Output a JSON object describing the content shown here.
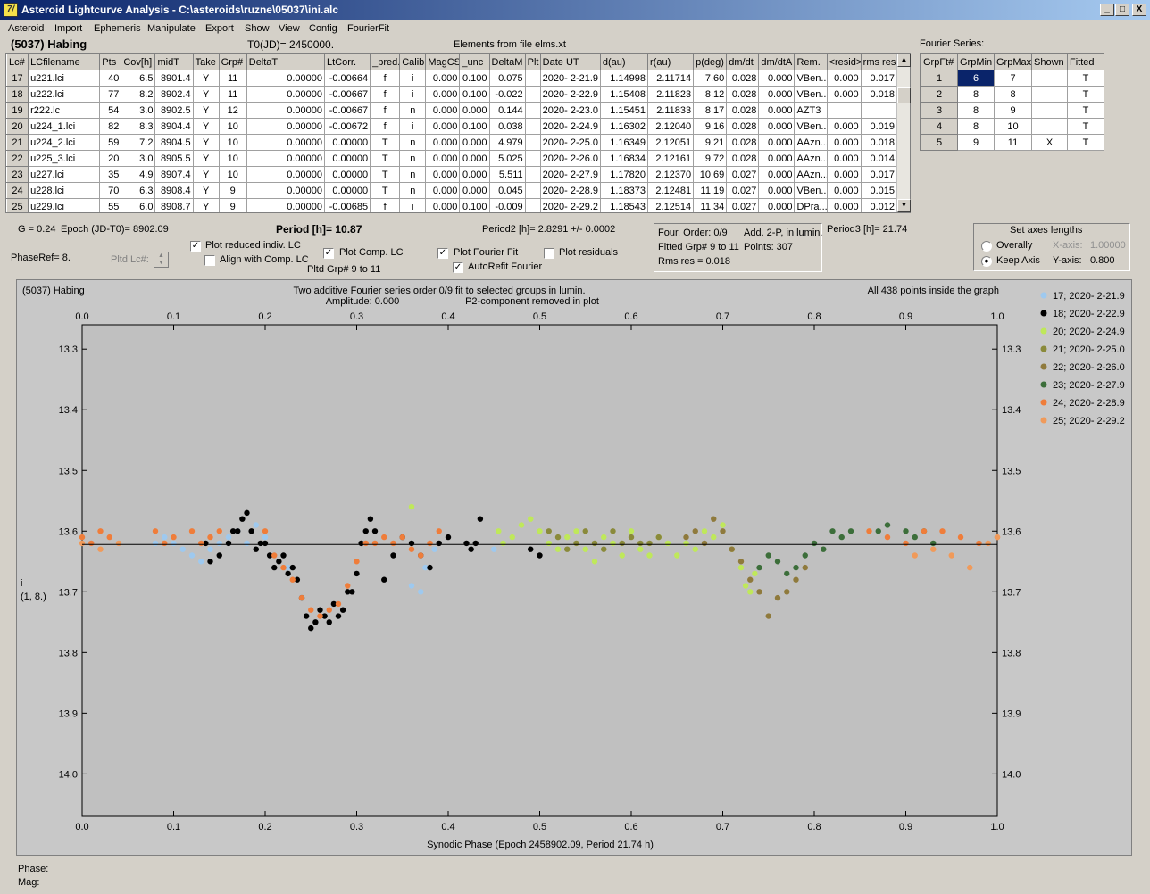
{
  "window": {
    "title": "Asteroid Lightcurve Analysis - C:\\asteroids\\ruzne\\05037\\ini.alc",
    "app_icon": "7/",
    "min": "_",
    "max": "□",
    "close": "X"
  },
  "menu": [
    "Asteroid",
    "Import",
    "Ephemeris",
    "Manipulate",
    "Export",
    "Show",
    "View",
    "Config",
    "FourierFit"
  ],
  "header": {
    "object": "(5037) Habing",
    "t0": "T0(JD)= 2450000.",
    "elements": "Elements from file elms.xt"
  },
  "lc_table": {
    "columns": [
      "Lc#",
      "LCfilename",
      "Pts",
      "Cov[h]",
      "midT",
      "Take",
      "Grp#",
      "DeltaT",
      "LtCorr.",
      "_pred.",
      "Calib.",
      "MagCS",
      "_unc",
      "DeltaM",
      "Plt",
      "Date UT",
      "d(au)",
      "r(au)",
      "p(deg)",
      "dm/dt",
      "dm/dtA",
      "Rem.",
      "<resid>",
      "rms res"
    ],
    "rows": [
      [
        "17",
        "u221.lci",
        "40",
        "6.5",
        "8901.4",
        "Y",
        "11",
        "0.00000",
        "-0.00664",
        "f",
        "i",
        "0.000",
        "0.100",
        "0.075",
        "",
        "2020- 2-21.9",
        "1.14998",
        "2.11714",
        "7.60",
        "0.028",
        "0.000",
        "VBen...",
        "0.000",
        "0.017"
      ],
      [
        "18",
        "u222.lci",
        "77",
        "8.2",
        "8902.4",
        "Y",
        "11",
        "0.00000",
        "-0.00667",
        "f",
        "i",
        "0.000",
        "0.100",
        "-0.022",
        "",
        "2020- 2-22.9",
        "1.15408",
        "2.11823",
        "8.12",
        "0.028",
        "0.000",
        "VBen...",
        "0.000",
        "0.018"
      ],
      [
        "19",
        "r222.lc",
        "54",
        "3.0",
        "8902.5",
        "Y",
        "12",
        "0.00000",
        "-0.00667",
        "f",
        "n",
        "0.000",
        "0.000",
        "0.144",
        "",
        "2020- 2-23.0",
        "1.15451",
        "2.11833",
        "8.17",
        "0.028",
        "0.000",
        "AZT3",
        "",
        ""
      ],
      [
        "20",
        "u224_1.lci",
        "82",
        "8.3",
        "8904.4",
        "Y",
        "10",
        "0.00000",
        "-0.00672",
        "f",
        "i",
        "0.000",
        "0.100",
        "0.038",
        "",
        "2020- 2-24.9",
        "1.16302",
        "2.12040",
        "9.16",
        "0.028",
        "0.000",
        "VBen...",
        "0.000",
        "0.019"
      ],
      [
        "21",
        "u224_2.lci",
        "59",
        "7.2",
        "8904.5",
        "Y",
        "10",
        "0.00000",
        "0.00000",
        "T",
        "n",
        "0.000",
        "0.000",
        "4.979",
        "",
        "2020- 2-25.0",
        "1.16349",
        "2.12051",
        "9.21",
        "0.028",
        "0.000",
        "AAzn...",
        "0.000",
        "0.018"
      ],
      [
        "22",
        "u225_3.lci",
        "20",
        "3.0",
        "8905.5",
        "Y",
        "10",
        "0.00000",
        "0.00000",
        "T",
        "n",
        "0.000",
        "0.000",
        "5.025",
        "",
        "2020- 2-26.0",
        "1.16834",
        "2.12161",
        "9.72",
        "0.028",
        "0.000",
        "AAzn...",
        "0.000",
        "0.014"
      ],
      [
        "23",
        "u227.lci",
        "35",
        "4.9",
        "8907.4",
        "Y",
        "10",
        "0.00000",
        "0.00000",
        "T",
        "n",
        "0.000",
        "0.000",
        "5.511",
        "",
        "2020- 2-27.9",
        "1.17820",
        "2.12370",
        "10.69",
        "0.027",
        "0.000",
        "AAzn...",
        "0.000",
        "0.017"
      ],
      [
        "24",
        "u228.lci",
        "70",
        "6.3",
        "8908.4",
        "Y",
        "9",
        "0.00000",
        "0.00000",
        "T",
        "n",
        "0.000",
        "0.000",
        "0.045",
        "",
        "2020- 2-28.9",
        "1.18373",
        "2.12481",
        "11.19",
        "0.027",
        "0.000",
        "VBen...",
        "0.000",
        "0.015"
      ],
      [
        "25",
        "u229.lci",
        "55",
        "6.0",
        "8908.7",
        "Y",
        "9",
        "0.00000",
        "-0.00685",
        "f",
        "i",
        "0.000",
        "0.100",
        "-0.009",
        "",
        "2020- 2-29.2",
        "1.18543",
        "2.12514",
        "11.34",
        "0.027",
        "0.000",
        "DPra...",
        "0.000",
        "0.012"
      ]
    ]
  },
  "fourier": {
    "title": "Fourier Series:",
    "columns": [
      "GrpFt#",
      "GrpMin",
      "GrpMax",
      "Shown",
      "Fitted"
    ],
    "rows": [
      [
        "1",
        "6",
        "7",
        "",
        "T"
      ],
      [
        "2",
        "8",
        "8",
        "",
        "T"
      ],
      [
        "3",
        "8",
        "9",
        "",
        "T"
      ],
      [
        "4",
        "8",
        "10",
        "",
        "T"
      ],
      [
        "5",
        "9",
        "11",
        "X",
        "T"
      ]
    ]
  },
  "controls": {
    "g": "G = 0.24",
    "epoch": "Epoch (JD-T0)= 8902.09",
    "period": "Period [h]= 10.87",
    "period2": "Period2 [h]= 2.8291 +/- 0.0002",
    "period3": "Period3 [h]= 21.74",
    "phaseref": "PhaseRef= 8.",
    "pltd_lc": "Pltd Lc#:",
    "plot_reduced": "Plot reduced indiv. LC",
    "align_comp": "Align with Comp. LC",
    "plot_comp": "Plot Comp. LC",
    "pltd_grp": "Pltd Grp#  9   to   11",
    "plot_fourier": "Plot Fourier Fit",
    "autorefit": "AutoRefit Fourier",
    "plot_residuals": "Plot residuals",
    "four_order": "Four. Order:  0/9",
    "add2p": "Add. 2-P, in lumin.",
    "fitted_grp": "Fitted Grp# 9 to 11",
    "points": "Points: 307",
    "rms": "Rms res     = 0.018",
    "axes_title": "Set axes lengths",
    "overally": "Overally",
    "keep_axis": "Keep Axis",
    "x_axis_label": "X-axis:",
    "x_axis_val": "1.00000",
    "y_axis_label": "Y-axis:",
    "y_axis_val": "0.800"
  },
  "plot_text": {
    "top_left": "(5037) Habing",
    "top_center1": "Two additive Fourier series order 0/9 fit to selected groups in lumin.",
    "top_center2": "Amplitude: 0.000",
    "top_center3": "P2-component removed in plot",
    "top_right": "All 438 points inside the graph",
    "ylabel1": "i",
    "ylabel2": "(1, 8.)",
    "footer_phase": "Phase:",
    "footer_mag": "Mag:"
  },
  "chart_data": {
    "type": "scatter",
    "xlabel": "Synodic Phase (Epoch 2458902.09, Period 21.74 h)",
    "ylabel": "i",
    "xlim": [
      0.0,
      1.0
    ],
    "ylim": [
      14.07,
      13.26
    ],
    "x_ticks": [
      0.0,
      0.1,
      0.2,
      0.3,
      0.4,
      0.5,
      0.6,
      0.7,
      0.8,
      0.9,
      1.0
    ],
    "y_ticks": [
      13.3,
      13.4,
      13.5,
      13.6,
      13.7,
      13.8,
      13.9,
      14.0
    ],
    "fit_line_y": 13.622,
    "grid": false,
    "legend_position": "right",
    "series": [
      {
        "name": "17; 2020- 2-21.9",
        "color": "#9ec9ef",
        "points": [
          [
            0.08,
            13.62
          ],
          [
            0.09,
            13.61
          ],
          [
            0.1,
            13.62
          ],
          [
            0.11,
            13.63
          ],
          [
            0.12,
            13.64
          ],
          [
            0.13,
            13.65
          ],
          [
            0.14,
            13.63
          ],
          [
            0.15,
            13.62
          ],
          [
            0.16,
            13.61
          ],
          [
            0.17,
            13.6
          ],
          [
            0.18,
            13.62
          ],
          [
            0.19,
            13.59
          ],
          [
            0.2,
            13.61
          ],
          [
            0.21,
            13.64
          ],
          [
            0.225,
            13.66
          ],
          [
            0.36,
            13.69
          ],
          [
            0.37,
            13.7
          ],
          [
            0.375,
            13.66
          ],
          [
            0.385,
            13.63
          ],
          [
            0.39,
            13.6
          ],
          [
            0.45,
            13.63
          ],
          [
            0.46,
            13.62
          ]
        ]
      },
      {
        "name": "18; 2020- 2-22.9",
        "color": "#000000",
        "points": [
          [
            0.135,
            13.62
          ],
          [
            0.14,
            13.65
          ],
          [
            0.15,
            13.64
          ],
          [
            0.16,
            13.62
          ],
          [
            0.165,
            13.6
          ],
          [
            0.17,
            13.6
          ],
          [
            0.175,
            13.58
          ],
          [
            0.18,
            13.57
          ],
          [
            0.185,
            13.6
          ],
          [
            0.19,
            13.63
          ],
          [
            0.195,
            13.62
          ],
          [
            0.2,
            13.62
          ],
          [
            0.205,
            13.64
          ],
          [
            0.21,
            13.66
          ],
          [
            0.215,
            13.65
          ],
          [
            0.22,
            13.64
          ],
          [
            0.225,
            13.67
          ],
          [
            0.23,
            13.66
          ],
          [
            0.235,
            13.68
          ],
          [
            0.24,
            13.71
          ],
          [
            0.245,
            13.74
          ],
          [
            0.25,
            13.76
          ],
          [
            0.255,
            13.75
          ],
          [
            0.26,
            13.73
          ],
          [
            0.265,
            13.74
          ],
          [
            0.27,
            13.75
          ],
          [
            0.275,
            13.72
          ],
          [
            0.28,
            13.74
          ],
          [
            0.285,
            13.73
          ],
          [
            0.29,
            13.7
          ],
          [
            0.295,
            13.7
          ],
          [
            0.3,
            13.67
          ],
          [
            0.305,
            13.62
          ],
          [
            0.31,
            13.6
          ],
          [
            0.315,
            13.58
          ],
          [
            0.32,
            13.6
          ],
          [
            0.33,
            13.68
          ],
          [
            0.34,
            13.64
          ],
          [
            0.35,
            13.61
          ],
          [
            0.36,
            13.62
          ],
          [
            0.37,
            13.64
          ],
          [
            0.38,
            13.66
          ],
          [
            0.39,
            13.62
          ],
          [
            0.4,
            13.61
          ],
          [
            0.42,
            13.62
          ],
          [
            0.425,
            13.63
          ],
          [
            0.43,
            13.62
          ],
          [
            0.435,
            13.58
          ],
          [
            0.49,
            13.63
          ],
          [
            0.5,
            13.64
          ]
        ]
      },
      {
        "name": "20; 2020- 2-24.9",
        "color": "#bfe85a",
        "points": [
          [
            0.36,
            13.56
          ],
          [
            0.455,
            13.6
          ],
          [
            0.46,
            13.62
          ],
          [
            0.47,
            13.61
          ],
          [
            0.48,
            13.59
          ],
          [
            0.49,
            13.58
          ],
          [
            0.5,
            13.6
          ],
          [
            0.51,
            13.62
          ],
          [
            0.52,
            13.63
          ],
          [
            0.53,
            13.61
          ],
          [
            0.54,
            13.6
          ],
          [
            0.55,
            13.63
          ],
          [
            0.56,
            13.65
          ],
          [
            0.57,
            13.61
          ],
          [
            0.58,
            13.62
          ],
          [
            0.59,
            13.64
          ],
          [
            0.6,
            13.6
          ],
          [
            0.61,
            13.63
          ],
          [
            0.62,
            13.64
          ],
          [
            0.63,
            13.61
          ],
          [
            0.64,
            13.62
          ],
          [
            0.65,
            13.64
          ],
          [
            0.66,
            13.62
          ],
          [
            0.67,
            13.63
          ],
          [
            0.68,
            13.6
          ],
          [
            0.69,
            13.61
          ],
          [
            0.7,
            13.59
          ],
          [
            0.71,
            13.63
          ],
          [
            0.72,
            13.66
          ],
          [
            0.725,
            13.69
          ],
          [
            0.73,
            13.7
          ],
          [
            0.735,
            13.67
          ]
        ]
      },
      {
        "name": "21; 2020- 2-25.0",
        "color": "#8a8a3a",
        "points": [
          [
            0.51,
            13.6
          ],
          [
            0.52,
            13.61
          ],
          [
            0.53,
            13.63
          ],
          [
            0.54,
            13.62
          ],
          [
            0.55,
            13.6
          ],
          [
            0.56,
            13.62
          ],
          [
            0.57,
            13.63
          ],
          [
            0.58,
            13.6
          ],
          [
            0.59,
            13.62
          ],
          [
            0.6,
            13.61
          ],
          [
            0.61,
            13.62
          ],
          [
            0.62,
            13.62
          ],
          [
            0.63,
            13.61
          ]
        ]
      },
      {
        "name": "22; 2020- 2-26.0",
        "color": "#8f7a3c",
        "points": [
          [
            0.66,
            13.61
          ],
          [
            0.67,
            13.6
          ],
          [
            0.68,
            13.62
          ],
          [
            0.69,
            13.58
          ],
          [
            0.7,
            13.6
          ],
          [
            0.71,
            13.63
          ],
          [
            0.72,
            13.65
          ],
          [
            0.73,
            13.68
          ],
          [
            0.74,
            13.7
          ],
          [
            0.75,
            13.74
          ],
          [
            0.76,
            13.71
          ],
          [
            0.77,
            13.7
          ],
          [
            0.78,
            13.68
          ],
          [
            0.79,
            13.66
          ]
        ]
      },
      {
        "name": "23; 2020- 2-27.9",
        "color": "#3c6e3a",
        "points": [
          [
            0.74,
            13.66
          ],
          [
            0.75,
            13.64
          ],
          [
            0.76,
            13.65
          ],
          [
            0.77,
            13.67
          ],
          [
            0.78,
            13.66
          ],
          [
            0.79,
            13.64
          ],
          [
            0.8,
            13.62
          ],
          [
            0.81,
            13.63
          ],
          [
            0.82,
            13.6
          ],
          [
            0.83,
            13.61
          ],
          [
            0.84,
            13.6
          ],
          [
            0.87,
            13.6
          ],
          [
            0.88,
            13.59
          ],
          [
            0.9,
            13.6
          ],
          [
            0.91,
            13.61
          ],
          [
            0.92,
            13.6
          ],
          [
            0.93,
            13.62
          ]
        ]
      },
      {
        "name": "24; 2020- 2-28.9",
        "color": "#ef7d3a",
        "points": [
          [
            0.0,
            13.61
          ],
          [
            0.01,
            13.62
          ],
          [
            0.02,
            13.6
          ],
          [
            0.03,
            13.61
          ],
          [
            0.08,
            13.6
          ],
          [
            0.09,
            13.62
          ],
          [
            0.1,
            13.61
          ],
          [
            0.12,
            13.6
          ],
          [
            0.13,
            13.62
          ],
          [
            0.14,
            13.61
          ],
          [
            0.15,
            13.6
          ],
          [
            0.2,
            13.6
          ],
          [
            0.21,
            13.64
          ],
          [
            0.22,
            13.66
          ],
          [
            0.23,
            13.68
          ],
          [
            0.24,
            13.71
          ],
          [
            0.25,
            13.73
          ],
          [
            0.26,
            13.74
          ],
          [
            0.27,
            13.73
          ],
          [
            0.28,
            13.72
          ],
          [
            0.29,
            13.69
          ],
          [
            0.3,
            13.65
          ],
          [
            0.31,
            13.62
          ],
          [
            0.32,
            13.62
          ],
          [
            0.33,
            13.61
          ],
          [
            0.34,
            13.62
          ],
          [
            0.35,
            13.61
          ],
          [
            0.36,
            13.63
          ],
          [
            0.37,
            13.64
          ],
          [
            0.38,
            13.62
          ],
          [
            0.39,
            13.6
          ],
          [
            0.86,
            13.6
          ],
          [
            0.88,
            13.61
          ],
          [
            0.9,
            13.62
          ],
          [
            0.92,
            13.6
          ],
          [
            0.94,
            13.6
          ],
          [
            0.96,
            13.61
          ],
          [
            0.98,
            13.62
          ],
          [
            1.0,
            13.61
          ]
        ]
      },
      {
        "name": "25; 2020- 2-29.2",
        "color": "#f09a5a",
        "points": [
          [
            0.0,
            13.62
          ],
          [
            0.02,
            13.63
          ],
          [
            0.04,
            13.62
          ],
          [
            0.91,
            13.64
          ],
          [
            0.93,
            13.63
          ],
          [
            0.95,
            13.64
          ],
          [
            0.97,
            13.66
          ],
          [
            0.99,
            13.62
          ],
          [
            1.0,
            13.61
          ]
        ]
      }
    ]
  }
}
